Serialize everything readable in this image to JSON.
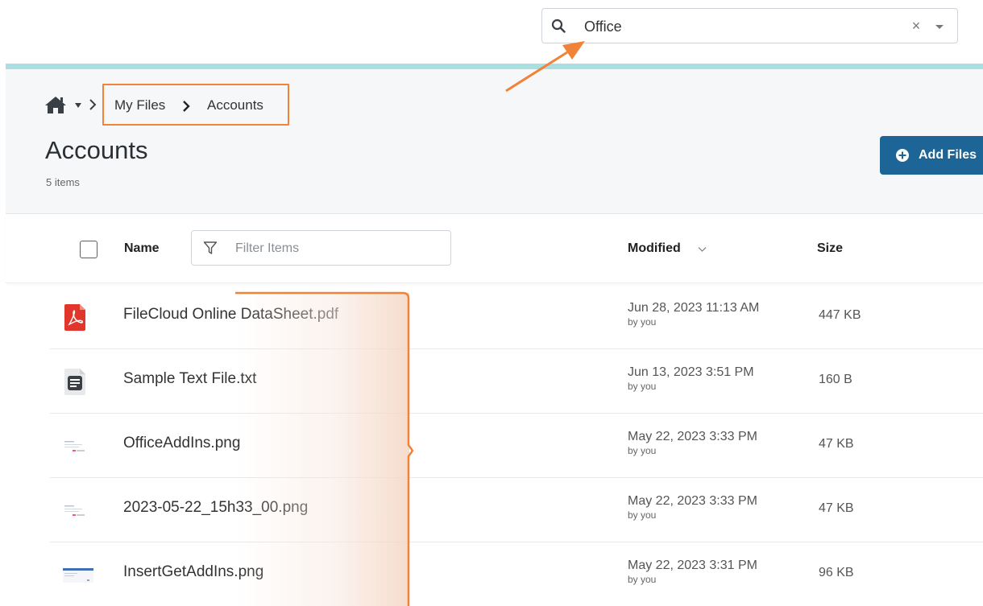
{
  "search": {
    "value": "Office",
    "clear_symbol": "×"
  },
  "breadcrumb": {
    "items": [
      "My Files",
      "Accounts"
    ]
  },
  "page": {
    "title": "Accounts",
    "item_count": "5 items"
  },
  "toolbar": {
    "add_files_label": "Add Files"
  },
  "table": {
    "headers": {
      "name": "Name",
      "modified": "Modified",
      "size": "Size"
    },
    "filter_placeholder": "Filter Items",
    "rows": [
      {
        "name": "FileCloud Online DataSheet.pdf",
        "modified": "Jun 28, 2023 11:13 AM",
        "by": "by you",
        "size": "447 KB",
        "icon": "pdf-file-icon"
      },
      {
        "name": "Sample Text File.txt",
        "modified": "Jun 13, 2023 3:51 PM",
        "by": "by you",
        "size": "160 B",
        "icon": "text-file-icon"
      },
      {
        "name": "OfficeAddIns.png",
        "modified": "May 22, 2023 3:33 PM",
        "by": "by you",
        "size": "47 KB",
        "icon": "image-thumbnail"
      },
      {
        "name": "2023-05-22_15h33_00.png",
        "modified": "May 22, 2023 3:33 PM",
        "by": "by you",
        "size": "47 KB",
        "icon": "image-thumbnail"
      },
      {
        "name": "InsertGetAddIns.png",
        "modified": "May 22, 2023 3:31 PM",
        "by": "by you",
        "size": "96 KB",
        "icon": "image-thumbnail"
      }
    ]
  },
  "colors": {
    "accent": "#f0823a",
    "primary_button": "#1d6596",
    "teal_bar": "#a9dfe1",
    "pdf_red": "#e0362c"
  }
}
